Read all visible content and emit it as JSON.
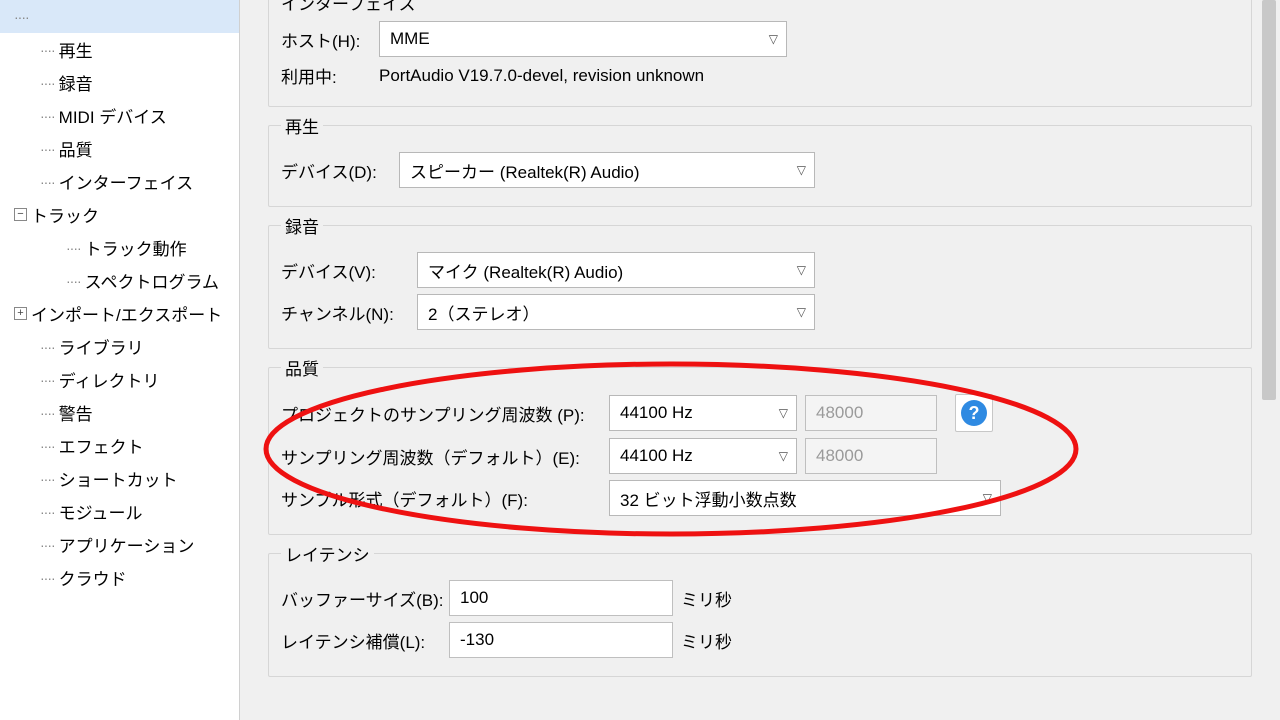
{
  "sidebar": {
    "items": [
      {
        "label": "再生"
      },
      {
        "label": "録音"
      },
      {
        "label": "MIDI デバイス"
      },
      {
        "label": "品質"
      },
      {
        "label": "インターフェイス"
      },
      {
        "label": "トラック",
        "expanded": true,
        "children": [
          {
            "label": "トラック動作"
          },
          {
            "label": "スペクトログラム"
          }
        ]
      },
      {
        "label": "インポート/エクスポート",
        "expanded": false
      },
      {
        "label": "ライブラリ"
      },
      {
        "label": "ディレクトリ"
      },
      {
        "label": "警告"
      },
      {
        "label": "エフェクト"
      },
      {
        "label": "ショートカット"
      },
      {
        "label": "モジュール"
      },
      {
        "label": "アプリケーション"
      },
      {
        "label": "クラウド"
      }
    ]
  },
  "interface": {
    "legend": "インターフェイス",
    "host_label": "ホスト(H):",
    "host_value": "MME",
    "using_label": "利用中:",
    "using_value": "PortAudio V19.7.0-devel, revision unknown"
  },
  "playback": {
    "legend": "再生",
    "device_label": "デバイス(D):",
    "device_value": "スピーカー (Realtek(R) Audio)"
  },
  "recording": {
    "legend": "録音",
    "device_label": "デバイス(V):",
    "device_value": "マイク (Realtek(R) Audio)",
    "channel_label": "チャンネル(N):",
    "channel_value": "2（ステレオ）"
  },
  "quality": {
    "legend": "品質",
    "project_rate_label": "プロジェクトのサンプリング周波数 (P):",
    "project_rate_value": "44100 Hz",
    "project_rate_alt": "48000",
    "default_rate_label": "サンプリング周波数（デフォルト）(E):",
    "default_rate_value": "44100 Hz",
    "default_rate_alt": "48000",
    "format_label": "サンプル形式（デフォルト）(F):",
    "format_value": "32 ビット浮動小数点数"
  },
  "latency": {
    "legend": "レイテンシ",
    "buffer_label": "バッファーサイズ(B):",
    "buffer_value": "100",
    "buffer_unit": "ミリ秒",
    "comp_label": "レイテンシ補償(L):",
    "comp_value": "-130",
    "comp_unit": "ミリ秒"
  },
  "icons": {
    "expand_plus": "+",
    "expand_minus": "−",
    "help": "?"
  }
}
